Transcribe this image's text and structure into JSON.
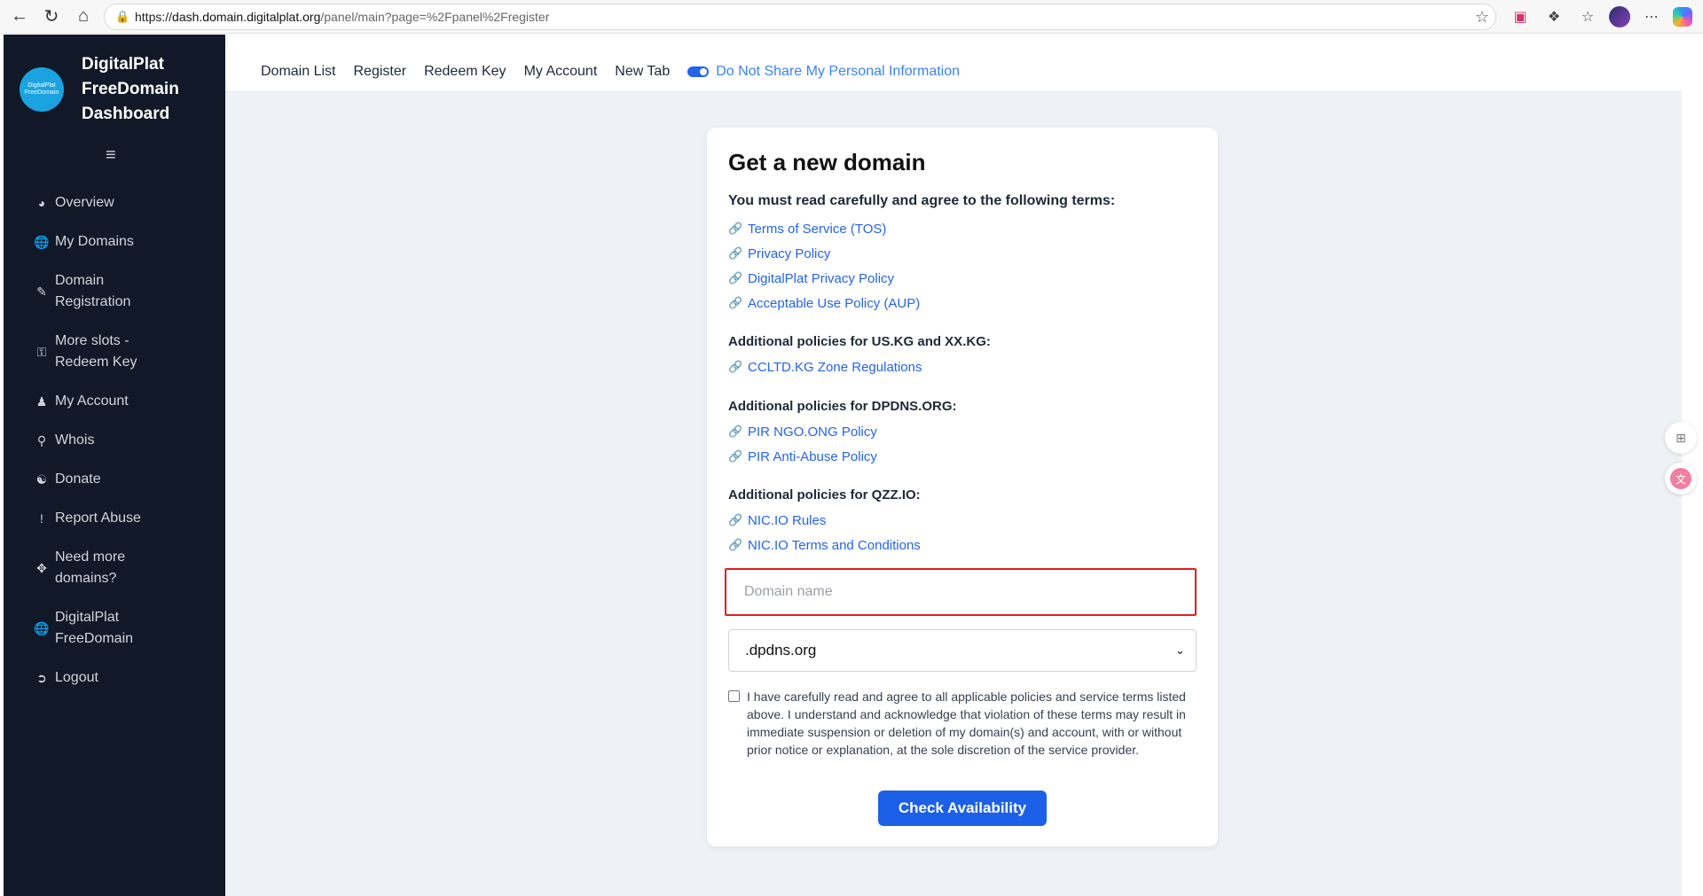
{
  "browser": {
    "url_prefix": "https://",
    "url_host": "dash.domain.digitalplat.org",
    "url_path": "/panel/main?page=%2Fpanel%2Fregister"
  },
  "sidebar": {
    "logo_text": "DigitalPlat FreeDomain",
    "brand_title_line1": "DigitalPlat",
    "brand_title_line2": "FreeDomain",
    "brand_title_line3": "Dashboard",
    "items": [
      {
        "label": "Overview",
        "icon": "dashboard-icon"
      },
      {
        "label": "My Domains",
        "icon": "globe-icon"
      },
      {
        "label_line1": "Domain",
        "label_line2": "Registration",
        "icon": "edit-icon"
      },
      {
        "label_line1": "More slots -",
        "label_line2": "Redeem Key",
        "icon": "key-icon"
      },
      {
        "label": "My Account",
        "icon": "user-icon"
      },
      {
        "label": "Whois",
        "icon": "search-icon"
      },
      {
        "label": "Donate",
        "icon": "donate-icon"
      },
      {
        "label": "Report Abuse",
        "icon": "exclamation-icon"
      },
      {
        "label_line1": "Need more",
        "label_line2": "domains?",
        "icon": "move-icon"
      },
      {
        "label_line1": "DigitalPlat",
        "label_line2": "FreeDomain",
        "icon": "globe-icon"
      },
      {
        "label": "Logout",
        "icon": "logout-icon"
      }
    ]
  },
  "topnav": {
    "items": [
      "Domain List",
      "Register",
      "Redeem Key",
      "My Account",
      "New Tab"
    ],
    "privacy_link": "Do Not Share My Personal Information"
  },
  "card": {
    "title": "Get a new domain",
    "lead": "You must read carefully and agree to the following terms:",
    "links_main": [
      "Terms of Service (TOS)",
      "Privacy Policy",
      "DigitalPlat Privacy Policy",
      "Acceptable Use Policy (AUP)"
    ],
    "section_kg": "Additional policies for US.KG and XX.KG:",
    "links_kg": [
      "CCLTD.KG Zone Regulations"
    ],
    "section_dpdns": "Additional policies for DPDNS.ORG:",
    "links_dpdns": [
      "PIR NGO.ONG Policy",
      "PIR Anti-Abuse Policy"
    ],
    "section_qzz": "Additional policies for QZZ.IO:",
    "links_qzz": [
      "NIC.IO Rules",
      "NIC.IO Terms and Conditions"
    ],
    "domain_placeholder": "Domain name",
    "domain_value": "",
    "tld_selected": ".dpdns.org",
    "agree_text": "I have carefully read and agree to all applicable policies and service terms listed above. I understand and acknowledge that violation of these terms may result in immediate suspension or deletion of my domain(s) and account, with or without prior notice or explanation, at the sole discretion of the service provider.",
    "agree_checked": false,
    "submit_label": "Check Availability"
  },
  "colors": {
    "sidebar_bg": "#111827",
    "link_blue": "#2563eb",
    "button_blue": "#1d60e8",
    "highlight_red": "#e11d1d",
    "page_bg": "#eef1f5"
  }
}
